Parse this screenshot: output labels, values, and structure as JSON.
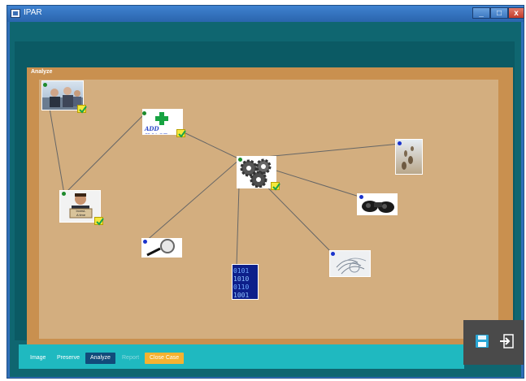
{
  "window": {
    "title": "IPAR",
    "minimize_glyph": "_",
    "maximize_glyph": "□",
    "close_glyph": "x"
  },
  "panel": {
    "title": "Analyze"
  },
  "board": {
    "connection_color": "#666666",
    "dot_colors": {
      "linked": "#1d8a2c",
      "unlinked": "#1a33cc"
    }
  },
  "nodes": [
    {
      "name": "office-people-photo",
      "check": true
    },
    {
      "name": "add-image",
      "label": "ADD IMAGE",
      "check": true
    },
    {
      "name": "gears",
      "check": true
    },
    {
      "name": "person-cardboard-sign",
      "sign": "Invest-\nA time",
      "check": true
    },
    {
      "name": "magnifying-glass",
      "check": false
    },
    {
      "name": "binary-code",
      "check": false
    },
    {
      "name": "binoculars",
      "check": false
    },
    {
      "name": "footprints-in-sand",
      "check": false
    },
    {
      "name": "fingerprint",
      "check": false
    }
  ],
  "toolbar": {
    "items": [
      "Image",
      "Preserve",
      "Analyze",
      "Report",
      "Close Case"
    ],
    "active": "Analyze"
  },
  "actions": {
    "save_icon": "floppy-disk-icon",
    "exit_icon": "exit-icon"
  },
  "colors": {
    "accent_orange": "#f5b230",
    "active_tab": "#114b7a",
    "toolbar_bg": "#1fb9c0",
    "check": "#f4e83b"
  }
}
